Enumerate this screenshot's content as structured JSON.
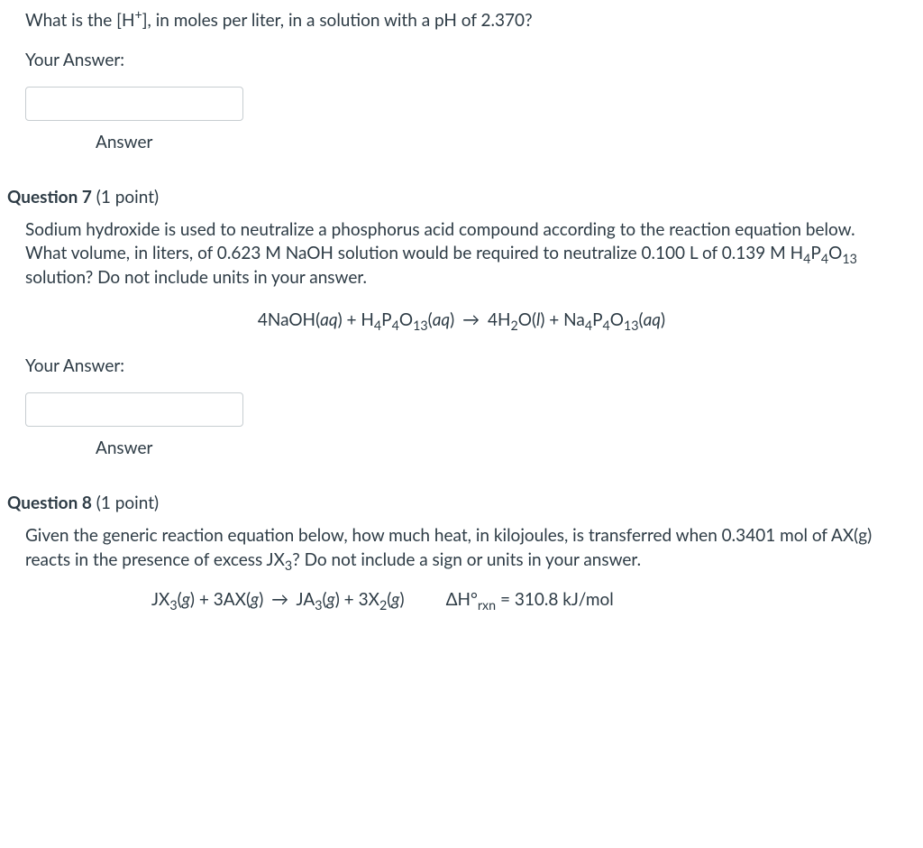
{
  "q6": {
    "prompt_prefix": "What is the [H",
    "prompt_suffix": "], in moles per liter, in a solution with a pH of 2.370?",
    "your_answer_label": "Your Answer:",
    "answer_caption": "Answer"
  },
  "q7": {
    "header_bold": "Question 7",
    "header_rest": " (1 point)",
    "prompt_p1": "Sodium hydroxide is used to neutralize a phosphorus acid compound according to the reaction equation below. What volume, in liters, of 0.623 M NaOH solution would be required to neutralize 0.100 L of 0.139 M H",
    "prompt_p2": " solution? Do not include units in your answer.",
    "eq_lhs1": "4NaOH(",
    "eq_aq": "aq",
    "eq_plus": ") + H",
    "eq_rparen_arrow": ") ",
    "eq_rhs1": " 4H",
    "eq_ol": "O(",
    "eq_l": "l",
    "eq_rhs2": ") + Na",
    "your_answer_label": "Your Answer:",
    "answer_caption": "Answer"
  },
  "q8": {
    "header_bold": "Question 8",
    "header_rest": " (1 point)",
    "prompt_p1": "Given the generic reaction equation below, how much heat, in kilojoules, is transferred when 0.3401 mol of AX(g) reacts in the presence of excess JX",
    "prompt_p2": "? Do not include units in your answer.",
    "prompt_mid": " Do not include a sign or units in your answer.",
    "eq_lhs": "JX",
    "eq_g": "g",
    "eq_plus3ax": ") + 3AX(",
    "eq_arrow_ja": " JA",
    "eq_plus3x": ") + 3X",
    "dh_prefix": "ΔH°",
    "dh_sub": "rxn",
    "dh_value": " = 310.8 kJ/mol"
  },
  "subs": {
    "sup_plus": "+",
    "s4": "4",
    "s13": "13",
    "s2": "2",
    "s3": "3"
  }
}
